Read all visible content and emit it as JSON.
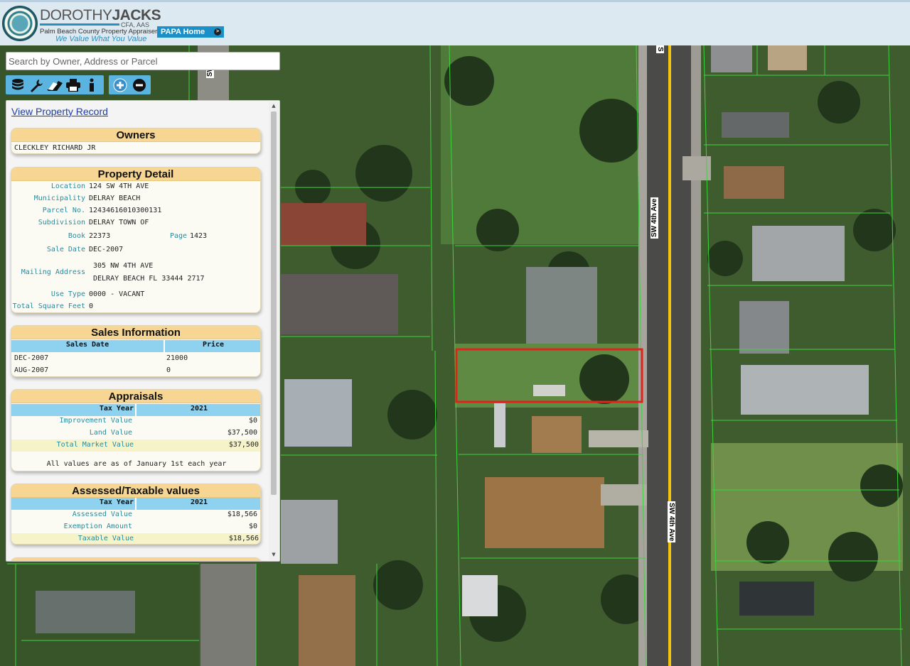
{
  "header": {
    "brand_first": "DOROTHY",
    "brand_last": "JACKS",
    "brand_credentials": "CFA, AAS",
    "brand_org": "Palm Beach County Property Appraiser",
    "brand_slogan": "We Value What You Value",
    "seal_text": "PALM BEACH COUNTY PROPERTY APPRAISER",
    "papa_home_label": "PAPA Home",
    "papa_arrow": ">"
  },
  "search": {
    "placeholder": "Search by Owner, Address or Parcel"
  },
  "toolbar": {
    "tools": [
      "layers-icon",
      "wrench-icon",
      "eraser-icon",
      "print-icon",
      "info-icon"
    ],
    "zoom": [
      "zoom-in-icon",
      "zoom-out-icon"
    ]
  },
  "map": {
    "street_labels": [
      "SW 4th Ave",
      "SW 4th Ave",
      "S",
      "SW"
    ],
    "colors": {
      "parcel_lines": "#3fd43f",
      "selected_parcel": "#e0241c",
      "road_center": "#f2c40e"
    }
  },
  "panel": {
    "view_record_link": "View Property Record",
    "owners": {
      "title": "Owners",
      "name": "CLECKLEY RICHARD JR"
    },
    "property_detail": {
      "title": "Property Detail",
      "location_label": "Location",
      "location": "124 SW 4TH AVE",
      "municipality_label": "Municipality",
      "municipality": "DELRAY BEACH",
      "parcel_label": "Parcel No.",
      "parcel": "12434616010300131",
      "subdivision_label": "Subdivision",
      "subdivision": "DELRAY TOWN OF",
      "book_label": "Book",
      "book": "22373",
      "page_label": "Page",
      "page": "1423",
      "sale_date_label": "Sale Date",
      "sale_date": "DEC-2007",
      "mailing_label": "Mailing Address",
      "mailing_line1": "305 NW 4TH AVE",
      "mailing_line2": "DELRAY BEACH FL 33444 2717",
      "use_type_label": "Use Type",
      "use_type": "0000 - VACANT",
      "sqft_label": "Total Square Feet",
      "sqft": "0"
    },
    "sales": {
      "title": "Sales Information",
      "col_date": "Sales Date",
      "col_price": "Price",
      "rows": [
        {
          "date": "DEC-2007",
          "price": "21000"
        },
        {
          "date": "AUG-2007",
          "price": "0"
        }
      ]
    },
    "appraisals": {
      "title": "Appraisals",
      "col_tax_year": "Tax Year",
      "year": "2021",
      "improvement_label": "Improvement Value",
      "improvement": "$0",
      "land_label": "Land Value",
      "land": "$37,500",
      "total_label": "Total Market Value",
      "total": "$37,500",
      "note": "All values are as of January 1st each year"
    },
    "assessed": {
      "title": "Assessed/Taxable values",
      "col_tax_year": "Tax Year",
      "year": "2021",
      "assessed_label": "Assessed Value",
      "assessed": "$18,566",
      "exemption_label": "Exemption Amount",
      "exemption": "$0",
      "taxable_label": "Taxable Value",
      "taxable": "$18,566"
    }
  }
}
